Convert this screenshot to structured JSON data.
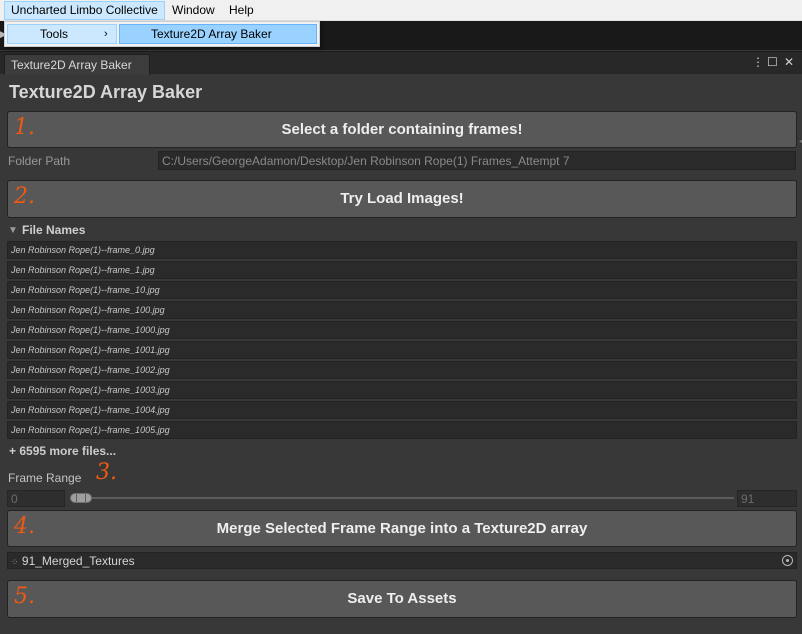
{
  "menubar": {
    "items": [
      "Uncharted Limbo Collective",
      "Window",
      "Help"
    ]
  },
  "dropdown": {
    "tools_label": "Tools",
    "tools_chevron": "›",
    "submenu_item": "Texture2D Array Baker"
  },
  "edge_arrow": "▶",
  "window": {
    "tab_title": "Texture2D Array Baker",
    "controls": {
      "more": "⋮",
      "maximize": "☐",
      "close": "✕"
    }
  },
  "panel_title": "Texture2D Array Baker",
  "steps": {
    "s1": {
      "number": "1.",
      "button": "Select a folder containing frames!"
    },
    "s2": {
      "number": "2.",
      "button": "Try Load Images!"
    },
    "s3": {
      "number": "3."
    },
    "s4": {
      "number": "4.",
      "button": "Merge Selected Frame Range into a Texture2D array"
    },
    "s5": {
      "number": "5.",
      "button": "Save To Assets"
    }
  },
  "folder": {
    "label": "Folder Path",
    "value": "C:/Users/GeorgeAdamon/Desktop/Jen Robinson Rope(1) Frames_Attempt 7"
  },
  "file_names": {
    "foldout_icon": "▼",
    "label": "File Names",
    "files": [
      "Jen Robinson Rope(1)--frame_0.jpg",
      "Jen Robinson Rope(1)--frame_1.jpg",
      "Jen Robinson Rope(1)--frame_10.jpg",
      "Jen Robinson Rope(1)--frame_100.jpg",
      "Jen Robinson Rope(1)--frame_1000.jpg",
      "Jen Robinson Rope(1)--frame_1001.jpg",
      "Jen Robinson Rope(1)--frame_1002.jpg",
      "Jen Robinson Rope(1)--frame_1003.jpg",
      "Jen Robinson Rope(1)--frame_1004.jpg",
      "Jen Robinson Rope(1)--frame_1005.jpg"
    ],
    "more": "+ 6595 more files..."
  },
  "frame_range": {
    "label": "Frame Range",
    "min": "0",
    "max": "91"
  },
  "output": {
    "icon": "⁘",
    "value": "91_Merged_Textures"
  },
  "side_arrow": "◂",
  "colors": {
    "annotation_orange": "#ee5a12",
    "menu_highlight": "#cce8ff",
    "submenu_highlight": "#99d1ff",
    "panel_bg": "#383838"
  },
  "icons": {
    "window_more": "kebab-icon",
    "window_maximize": "maximize-icon",
    "window_close": "close-icon",
    "object_picker": "target-icon"
  }
}
